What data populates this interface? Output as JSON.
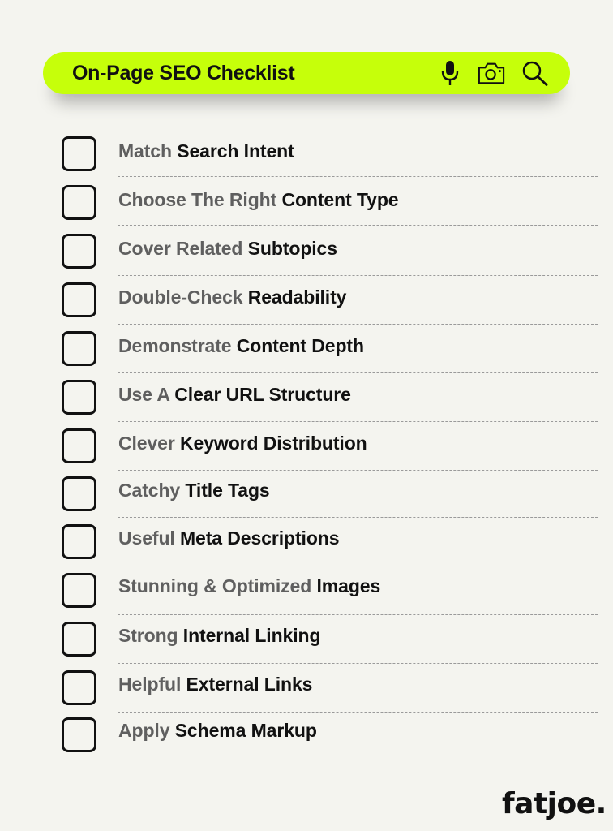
{
  "search_bar": {
    "title": "On-Page SEO Checklist",
    "icons": [
      "microphone-icon",
      "camera-icon",
      "search-icon"
    ],
    "accent_color": "#c6ff0a"
  },
  "checklist": {
    "items": [
      {
        "prefix": "Match",
        "emphasis": "Search Intent",
        "checked": false
      },
      {
        "prefix": "Choose The Right",
        "emphasis": "Content Type",
        "checked": false
      },
      {
        "prefix": "Cover Related",
        "emphasis": "Subtopics",
        "checked": false
      },
      {
        "prefix": "Double-Check",
        "emphasis": "Readability",
        "checked": false
      },
      {
        "prefix": "Demonstrate",
        "emphasis": "Content Depth",
        "checked": false
      },
      {
        "prefix": "Use A",
        "emphasis": "Clear URL Structure",
        "checked": false
      },
      {
        "prefix": "Clever",
        "emphasis": "Keyword Distribution",
        "checked": false
      },
      {
        "prefix": "Catchy",
        "emphasis": "Title Tags",
        "checked": false
      },
      {
        "prefix": "Useful",
        "emphasis": "Meta Descriptions",
        "checked": false
      },
      {
        "prefix": "Stunning & Optimized",
        "emphasis": "Images",
        "checked": false
      },
      {
        "prefix": "Strong",
        "emphasis": "Internal Linking",
        "checked": false
      },
      {
        "prefix": "Helpful",
        "emphasis": "External Links",
        "checked": false
      },
      {
        "prefix": "Apply",
        "emphasis": "Schema Markup",
        "checked": false
      }
    ]
  },
  "brand": {
    "logo_text": "fatjoe."
  }
}
